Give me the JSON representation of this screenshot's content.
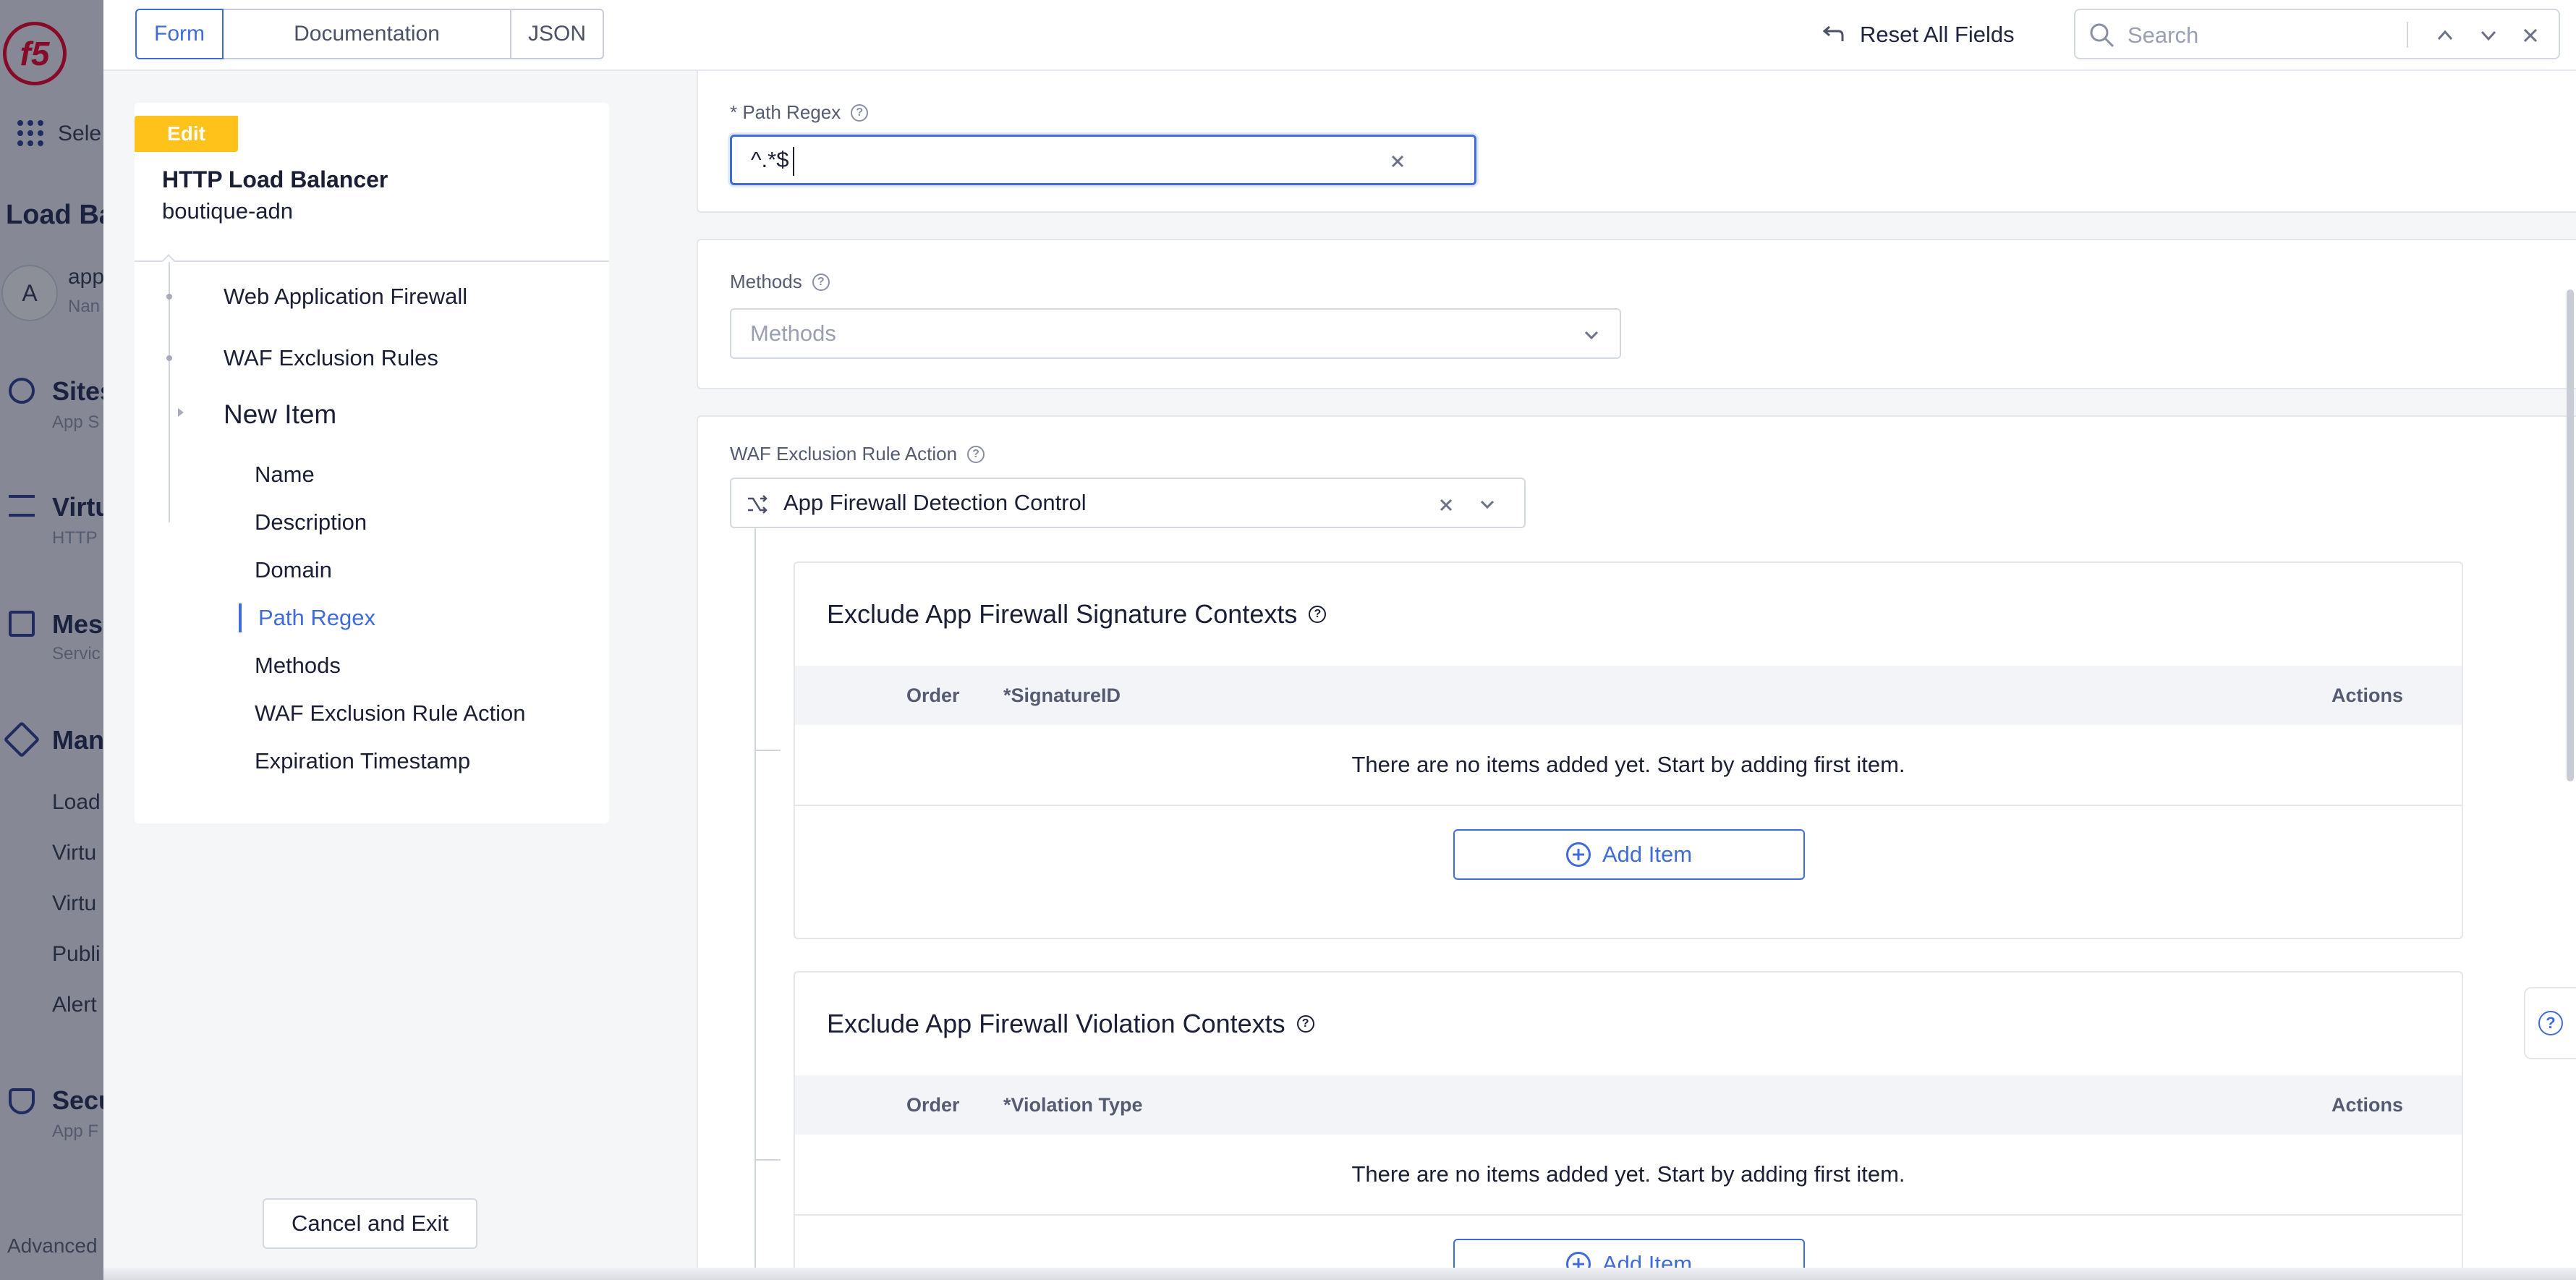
{
  "background_nav": {
    "logo": "f5",
    "select_label": "Sele",
    "section_title": "Load Ba",
    "avatar_letter": "A",
    "ns_name": "app",
    "ns_sub": "Nan",
    "items": [
      {
        "label": "Sites",
        "sub": "App S"
      },
      {
        "label": "Virtu",
        "sub": "HTTP"
      },
      {
        "label": "Mes",
        "sub": "Servic"
      },
      {
        "label": "Man",
        "sub": ""
      },
      {
        "label": "Load",
        "sub": ""
      },
      {
        "label": "Virtu",
        "sub": ""
      },
      {
        "label": "Virtu",
        "sub": ""
      },
      {
        "label": "Publi",
        "sub": ""
      },
      {
        "label": "Alert",
        "sub": ""
      },
      {
        "label": "Secu",
        "sub": "App F"
      }
    ],
    "advanced": "Advanced"
  },
  "topbar": {
    "tabs": [
      "Form",
      "Documentation",
      "JSON"
    ],
    "active_tab": "Form",
    "reset_label": "Reset All Fields",
    "search_placeholder": "Search"
  },
  "left": {
    "badge": "Edit",
    "object_type": "HTTP Load Balancer",
    "object_name": "boutique-adn",
    "nav_l1": [
      "Web Application Firewall",
      "WAF Exclusion Rules"
    ],
    "nav_current": "New Item",
    "nav_l2": [
      "Name",
      "Description",
      "Domain",
      "Path Regex",
      "Methods",
      "WAF Exclusion Rule Action",
      "Expiration Timestamp"
    ],
    "nav_active": "Path Regex",
    "cancel_label": "Cancel and Exit"
  },
  "form": {
    "path_regex": {
      "label": "* Path Regex",
      "value": "^.*$"
    },
    "methods": {
      "label": "Methods",
      "placeholder": "Methods"
    },
    "waf_action": {
      "label": "WAF Exclusion Rule Action",
      "value": "App Firewall Detection Control"
    },
    "signature_contexts": {
      "title": "Exclude App Firewall Signature Contexts",
      "columns": [
        "Order",
        "*SignatureID",
        "Actions"
      ],
      "empty": "There are no items added yet. Start by adding first item.",
      "add_label": "Add Item"
    },
    "violation_contexts": {
      "title": "Exclude App Firewall Violation Contexts",
      "columns": [
        "Order",
        "*Violation Type",
        "Actions"
      ],
      "empty": "There are no items added yet. Start by adding first item.",
      "add_label": "Add Item"
    }
  },
  "colors": {
    "accent": "#3f6bdc",
    "badge": "#ffc21a",
    "brand": "#e4002b"
  }
}
